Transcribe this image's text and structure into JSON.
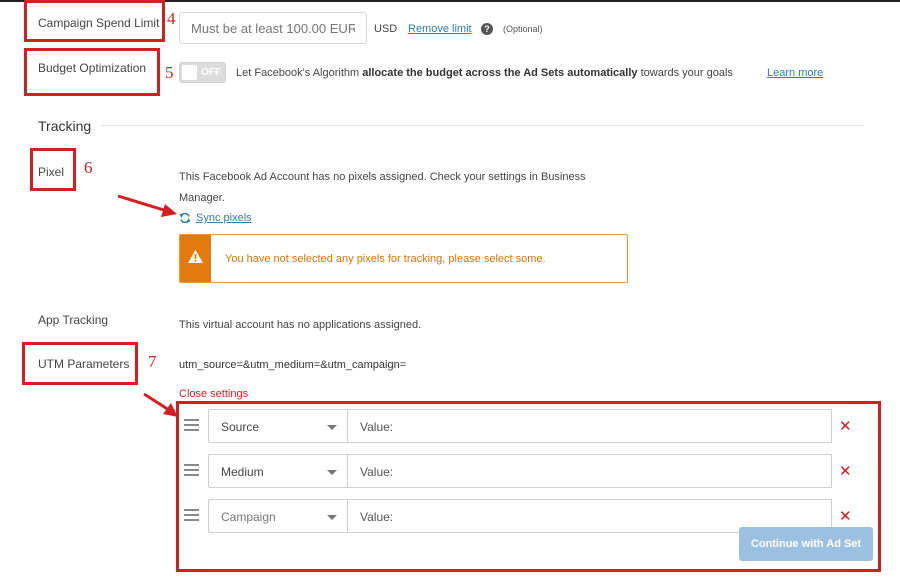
{
  "campaign_spend_limit": {
    "label": "Campaign Spend Limit",
    "step_number": "4",
    "input_placeholder": "Must be at least 100.00 EUR",
    "currency": "USD",
    "remove_limit_link": "Remove limit",
    "help_glyph": "?",
    "optional_note": "(Optional)"
  },
  "budget_optimization": {
    "label": "Budget Optimization",
    "step_number": "5",
    "toggle_state": "OFF",
    "description_prefix": "Let Facebook's Algorithm",
    "description_bold": "allocate the budget across the Ad Sets automatically",
    "description_suffix": "towards your goals",
    "learn_more_link": "Learn more"
  },
  "tracking": {
    "section_title": "Tracking"
  },
  "pixel": {
    "label": "Pixel",
    "step_number": "6",
    "message_line1": "This Facebook Ad Account has no pixels assigned. Check your settings in Business",
    "message_line2": "Manager.",
    "sync_link": "Sync pixels",
    "alert_text": "You have not selected any pixels for tracking, please select some.",
    "colors": {
      "alert": "#e27a0d",
      "link": "#2a7fb0"
    }
  },
  "app_tracking": {
    "label": "App Tracking",
    "message": "This virtual account has no applications assigned."
  },
  "utm_parameters": {
    "label": "UTM Parameters",
    "step_number": "7",
    "query_string": "utm_source=&utm_medium=&utm_campaign=",
    "close_settings_link": "Close settings",
    "rows": [
      {
        "param": "Source",
        "value_placeholder": "Value:"
      },
      {
        "param": "Medium",
        "value_placeholder": "Value:"
      },
      {
        "param": "Campaign",
        "value_placeholder": "Value:"
      }
    ]
  },
  "footer": {
    "continue_button": "Continue with Ad Set"
  },
  "annotation_color": "#d21f1f"
}
